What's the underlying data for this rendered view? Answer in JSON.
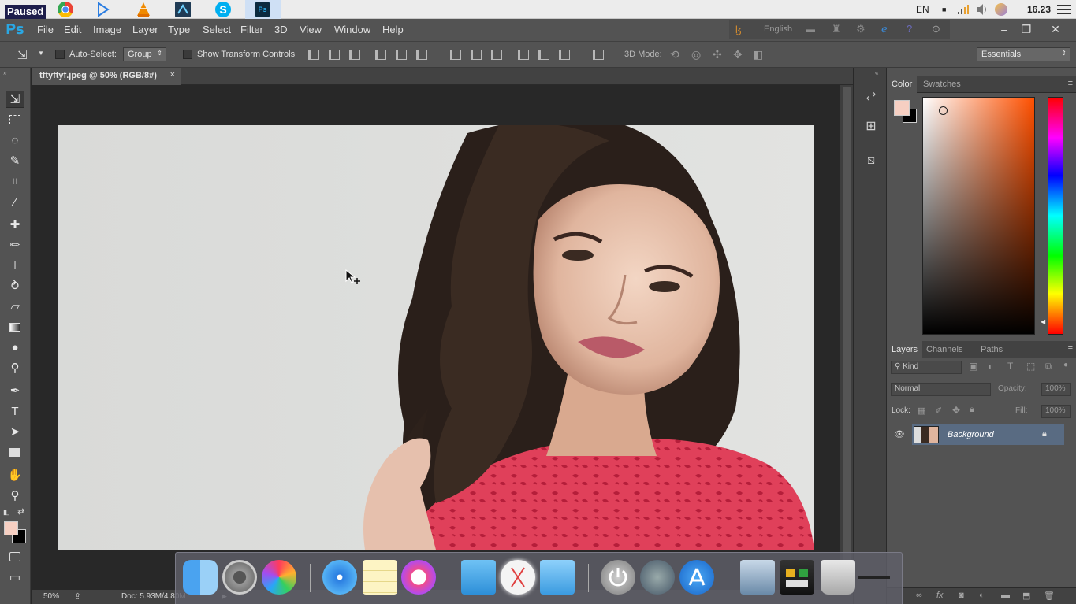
{
  "os": {
    "paused_label": "Paused",
    "language": "EN",
    "time": "16.23"
  },
  "app": {
    "logo": "Ps",
    "menu": [
      "File",
      "Edit",
      "Image",
      "Layer",
      "Type",
      "Select",
      "Filter",
      "3D",
      "View",
      "Window",
      "Help"
    ],
    "input_language": "English",
    "workspace": "Essentials"
  },
  "options_bar": {
    "auto_select_label": "Auto-Select:",
    "auto_select_value": "Group",
    "transform_controls_label": "Show Transform Controls",
    "mode_3d_label": "3D Mode:"
  },
  "document": {
    "tab_title": "tftyftyf.jpeg @ 50% (RGB/8#)",
    "close_glyph": "×",
    "zoom": "50%",
    "doc_info": "Doc: 5.93M/4.80M"
  },
  "color_panel": {
    "tabs": [
      "Color",
      "Swatches"
    ],
    "foreground": "#f6cfc2",
    "background": "#000000"
  },
  "layers_panel": {
    "tabs": [
      "Layers",
      "Channels",
      "Paths"
    ],
    "filter_kind": "Kind",
    "blend_mode": "Normal",
    "opacity_label": "Opacity:",
    "opacity_value": "100%",
    "lock_label": "Lock:",
    "fill_label": "Fill:",
    "fill_value": "100%",
    "layers": [
      {
        "name": "Background",
        "visible": true,
        "locked": true
      }
    ]
  },
  "colors": {
    "ui_dark": "#282828",
    "ui_mid": "#535353",
    "ps_blue": "#2aa7e3",
    "selected_layer": "#596b82"
  }
}
